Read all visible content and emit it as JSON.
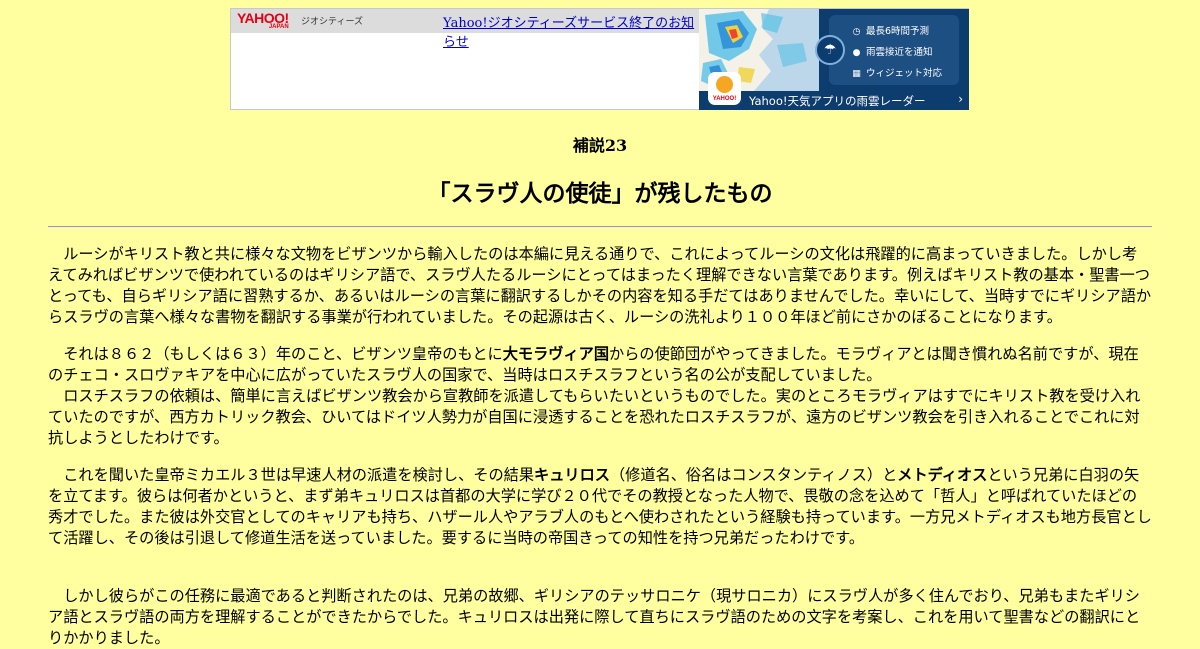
{
  "banner": {
    "logo_text": "YAHOO!",
    "logo_sub": "JAPAN",
    "brand": "ジオシティーズ",
    "notice_link": "Yahoo!ジオシティーズサービス終了のお知らせ"
  },
  "ad": {
    "features": [
      {
        "icon": "clock-icon",
        "label": "最長6時間予測"
      },
      {
        "icon": "pin-icon",
        "label": "雨雲接近を通知"
      },
      {
        "icon": "widget-icon",
        "label": "ウィジェット対応"
      }
    ],
    "app_brand": "YAHOO!",
    "caption": "Yahoo!天気アプリの雨雲レーダー"
  },
  "kicker": "補説23",
  "title": "「スラヴ人の使徒」が残したもの",
  "paragraphs": [
    {
      "text": "ルーシがキリスト教と共に様々な文物をビザンツから輸入したのは本編に見える通りで、これによってルーシの文化は飛躍的に高まっていきました。しかし考えてみればビザンツで使われているのはギリシア語で、スラヴ人たるルーシにとってはまったく理解できない言葉であります。例えばキリスト教の基本・聖書一つとっても、自らギリシア語に習熟するか、あるいはルーシの言葉に翻訳するしかその内容を知る手だてはありませんでした。幸いにして、当時すでにギリシア語からスラヴの言葉へ様々な書物を翻訳する事業が行われていました。その起源は古く、ルーシの洗礼より１００年ほど前にさかのぼることになります。"
    },
    {
      "text_before": "それは８６２（もしくは６３）年のこと、ビザンツ皇帝のもとに",
      "bold": "大モラヴィア国",
      "text_after": "からの使節団がやってきました。モラヴィアとは聞き慣れぬ名前ですが、現在のチェコ・スロヴァキアを中心に広がっていたスラヴ人の国家で、当時はロスチスラフという名の公が支配していました。"
    },
    {
      "text": "ロスチスラフの依頼は、簡単に言えばビザンツ教会から宣教師を派遣してもらいたいというものでした。実のところモラヴィアはすでにキリスト教を受け入れていたのですが、西方カトリック教会、ひいてはドイツ人勢力が自国に浸透することを恐れたロスチスラフが、遠方のビザンツ教会を引き入れることでこれに対抗しようとしたわけです。"
    },
    {
      "text_before": "これを聞いた皇帝ミカエル３世は早速人材の派遣を検討し、その結果",
      "bold1": "キュリロス",
      "text_mid": "（修道名、俗名はコンスタンティノス）と",
      "bold2": "メトディオス",
      "text_after": "という兄弟に白羽の矢を立てます。彼らは何者かというと、まず弟キュリロスは首都の大学に学び２０代でその教授となった人物で、畏敬の念を込めて「哲人」と呼ばれていたほどの秀才でした。また彼は外交官としてのキャリアも持ち、ハザール人やアラブ人のもとへ使わされたという経験も持っています。一方兄メトディオスも地方長官として活躍し、その後は引退して修道生活を送っていました。要するに当時の帝国きっての知性を持つ兄弟だったわけです。"
    },
    {
      "text": "しかし彼らがこの任務に最適であると判断されたのは、兄弟の故郷、ギリシアのテッサロニケ（現サロニカ）にスラヴ人が多く住んでおり、兄弟もまたギリシア語とスラヴ語の両方を理解することができたからでした。キュリロスは出発に際して直ちにスラヴ語のための文字を考案し、これを用いて聖書などの翻訳にとりかかりました。"
    }
  ]
}
